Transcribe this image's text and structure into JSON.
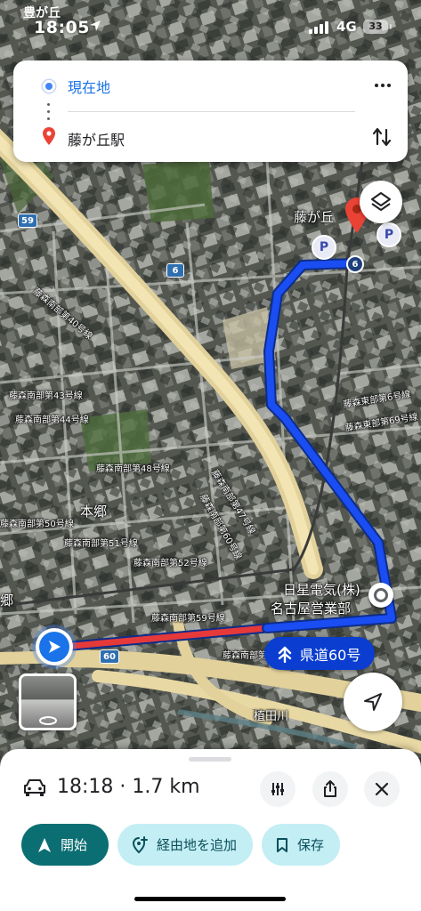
{
  "status_bar": {
    "city": "豊が丘",
    "time": "18:05",
    "network": "4G",
    "battery": "33"
  },
  "directions": {
    "origin": "現在地",
    "destination": "藤が丘駅"
  },
  "map": {
    "place_labels": [
      {
        "text": "藤が丘",
        "size": "big"
      },
      {
        "text": "本郷",
        "size": "big"
      },
      {
        "text": "郷",
        "size": "big"
      },
      {
        "text": "日星電気(株)",
        "size": "big"
      },
      {
        "text": "名古屋営業部",
        "size": "big"
      },
      {
        "text": "植田川",
        "size": "normal"
      },
      {
        "text": "藤森南部第40号線",
        "size": "small"
      },
      {
        "text": "藤森南部第43号線",
        "size": "small"
      },
      {
        "text": "藤森南部第44号線",
        "size": "small"
      },
      {
        "text": "藤森南部第48号線",
        "size": "small"
      },
      {
        "text": "藤森南部第47号線",
        "size": "small"
      },
      {
        "text": "藤森南部第60号線",
        "size": "small"
      },
      {
        "text": "藤森南部第50号線",
        "size": "small"
      },
      {
        "text": "藤森南部第51号線",
        "size": "small"
      },
      {
        "text": "藤森南部第52号線",
        "size": "small"
      },
      {
        "text": "藤森南部第59号線",
        "size": "small"
      },
      {
        "text": "藤森南部第7",
        "size": "small"
      },
      {
        "text": "藤森東部第6号線",
        "size": "small"
      },
      {
        "text": "藤森東部第69号線",
        "size": "small"
      }
    ],
    "road_shields": [
      "59",
      "6",
      "60"
    ],
    "route_number_marker": "6",
    "parking_label": "P",
    "route_chip": "県道60号"
  },
  "sheet": {
    "trip_summary": "18:18 · 1.7 km",
    "start_label": "開始",
    "add_stop_label": "経由地を追加",
    "save_label": "保存"
  },
  "colors": {
    "route_blue": "#1a4df2",
    "traffic_red": "#e5393a",
    "primary_button": "#0b6e73",
    "secondary_button": "#c2eef4"
  }
}
